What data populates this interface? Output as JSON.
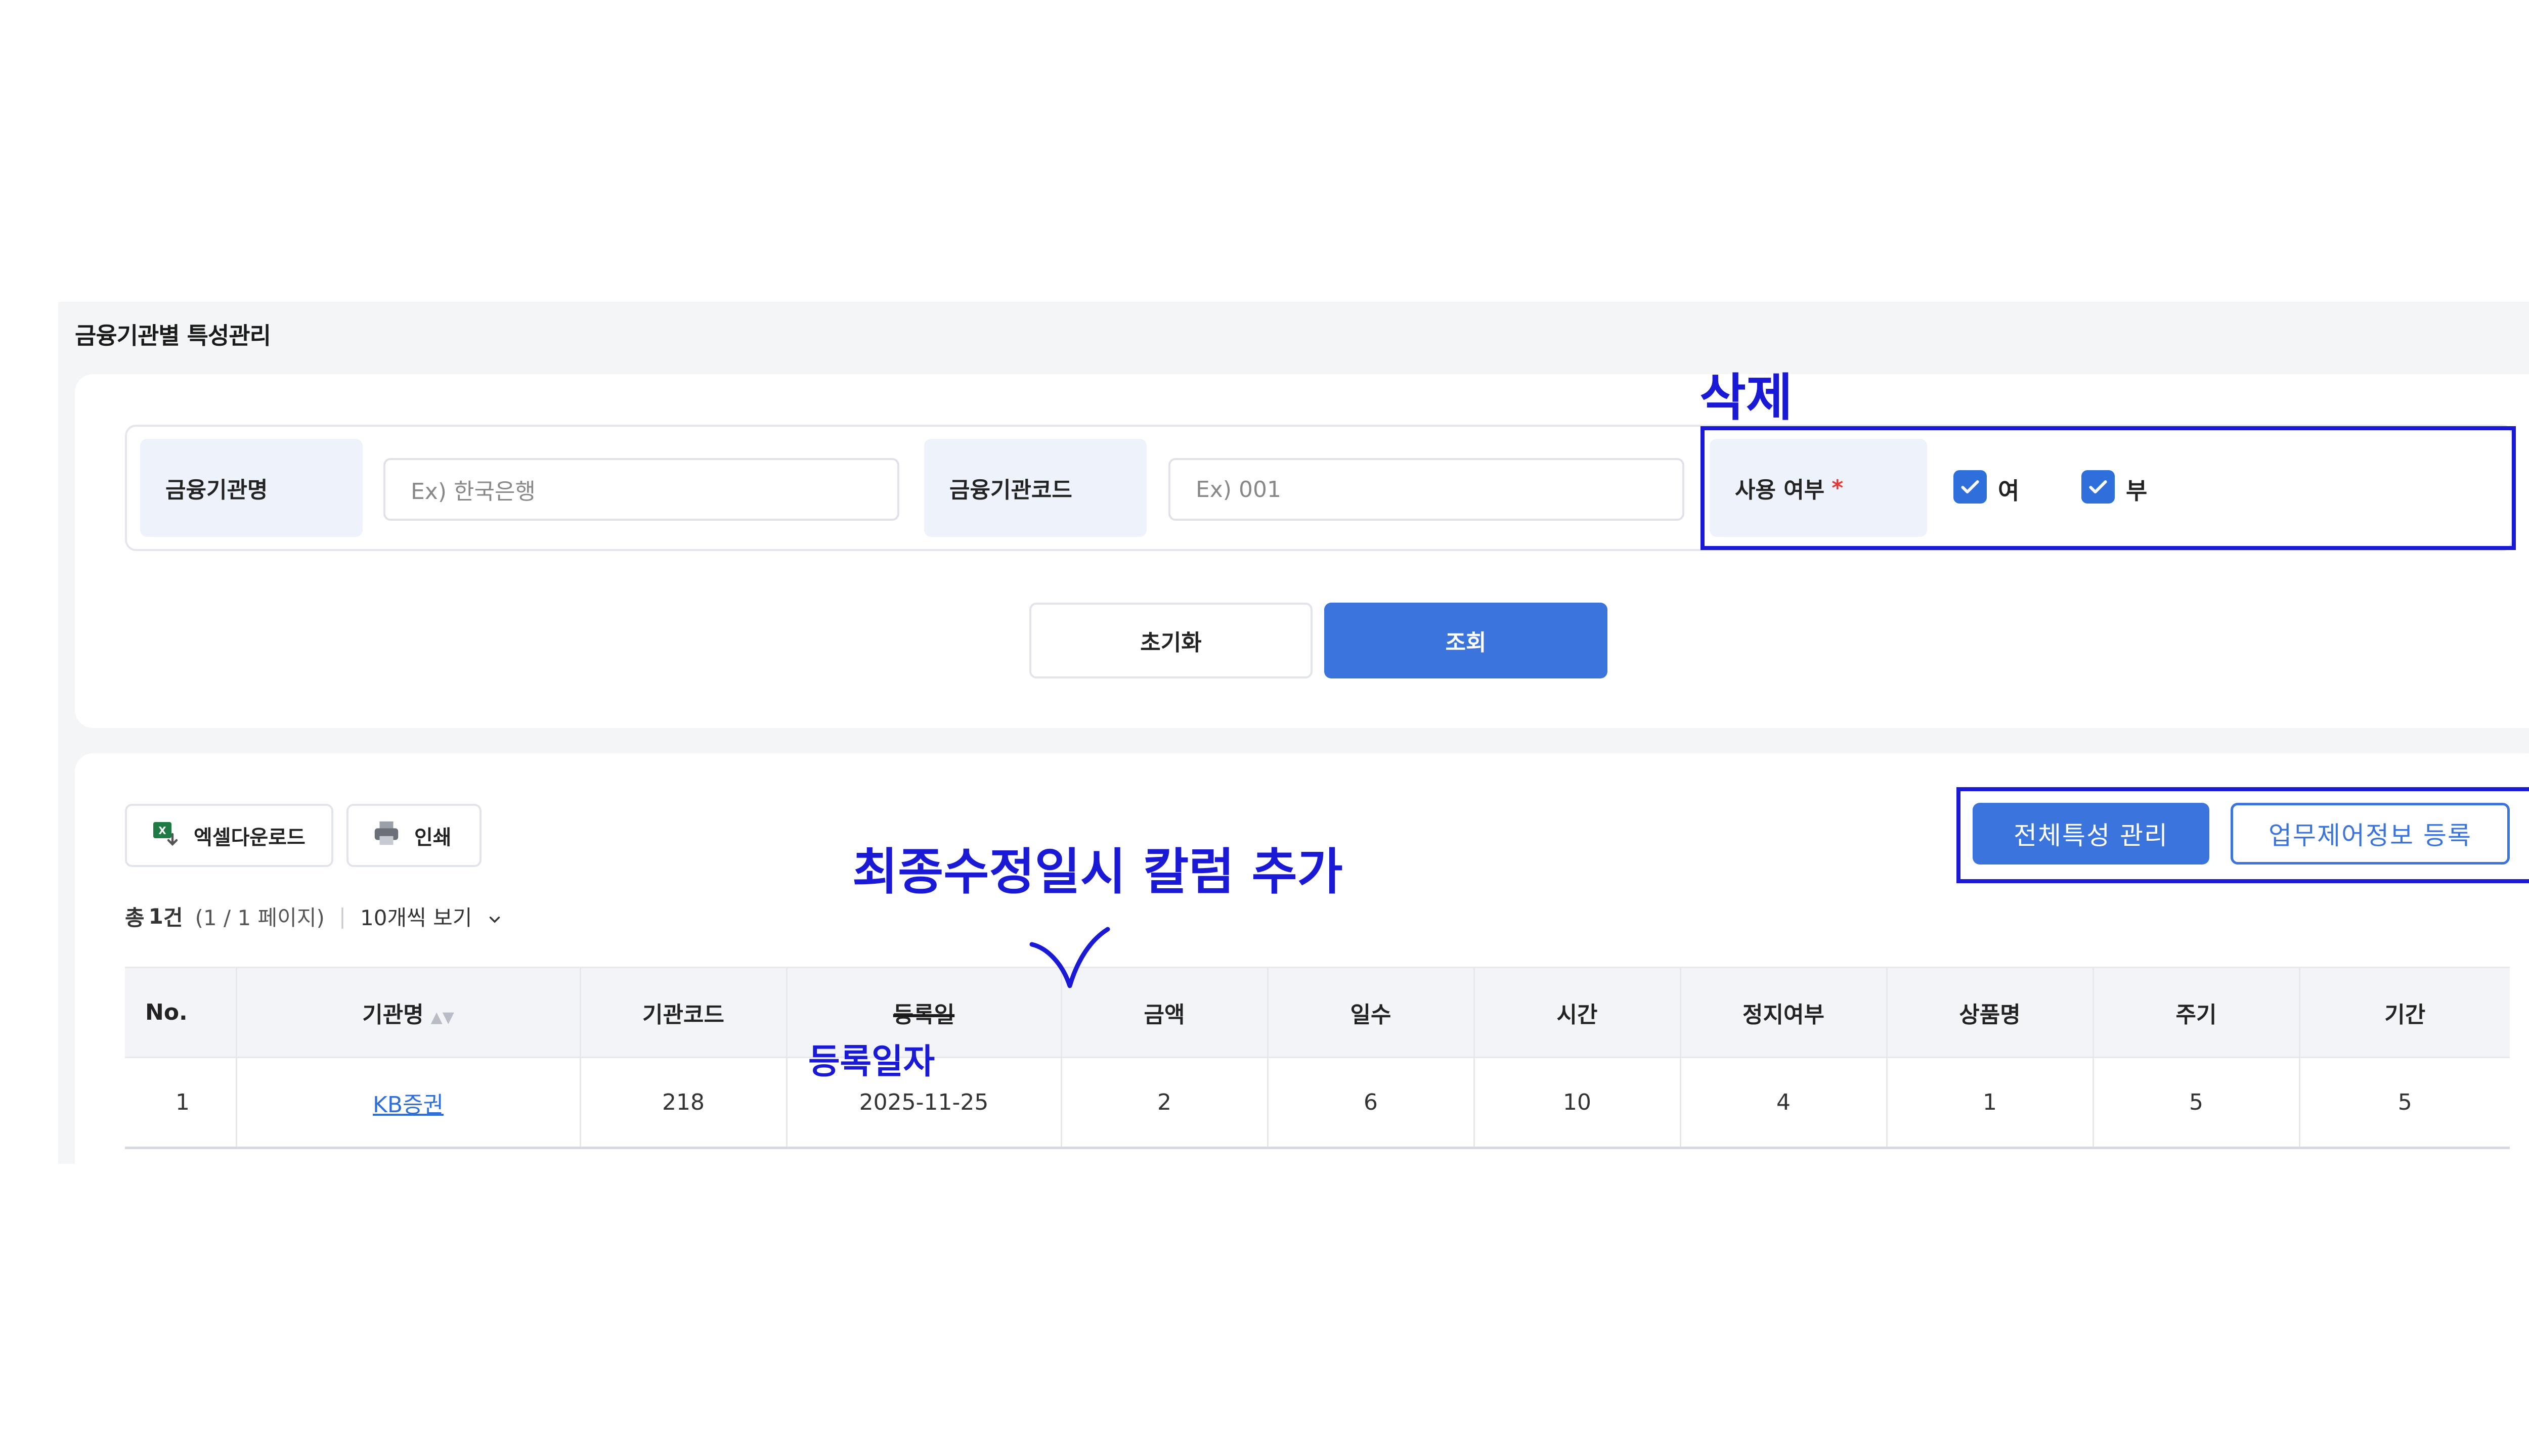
{
  "page": {
    "title": "금융기관별 특성관리"
  },
  "filters": {
    "institution_name_label": "금융기관명",
    "institution_name_placeholder": "Ex) 한국은행",
    "institution_code_label": "금융기관코드",
    "institution_code_placeholder": "Ex) 001",
    "use_yn_label": "사용 여부",
    "required_mark": "*",
    "options": [
      {
        "label": "여",
        "checked": true
      },
      {
        "label": "부",
        "checked": true
      }
    ]
  },
  "buttons": {
    "reset": "초기화",
    "search": "조회"
  },
  "toolbar": {
    "excel_download": "엑셀다운로드",
    "print": "인쇄",
    "manage_all": "전체특성 관리",
    "register_control": "업무제어정보 등록"
  },
  "summary": {
    "total_prefix": "총",
    "total_count": "1",
    "total_suffix": "건",
    "pages": "(1 / 1 페이지)",
    "page_size": "10개씩 보기"
  },
  "table": {
    "columns": [
      "No.",
      "기관명",
      "기관코드",
      "등록일",
      "금액",
      "일수",
      "시간",
      "정지여부",
      "상품명",
      "주기",
      "기간"
    ],
    "rows": [
      [
        "1",
        "KB증권",
        "218",
        "2025-11-25",
        "2",
        "6",
        "10",
        "4",
        "1",
        "5",
        "5"
      ]
    ]
  },
  "annotations": {
    "delete": "삭제",
    "add_column": "최종수정일시 칼럼 추가",
    "rename": "등록일자"
  },
  "colors": {
    "primary": "#3a74dc",
    "annotation": "#1a1ad6",
    "required": "#e53935"
  },
  "icons": [
    "excel-icon",
    "printer-icon",
    "checkbox-checked-icon",
    "chevron-down-icon",
    "sort-icon"
  ]
}
